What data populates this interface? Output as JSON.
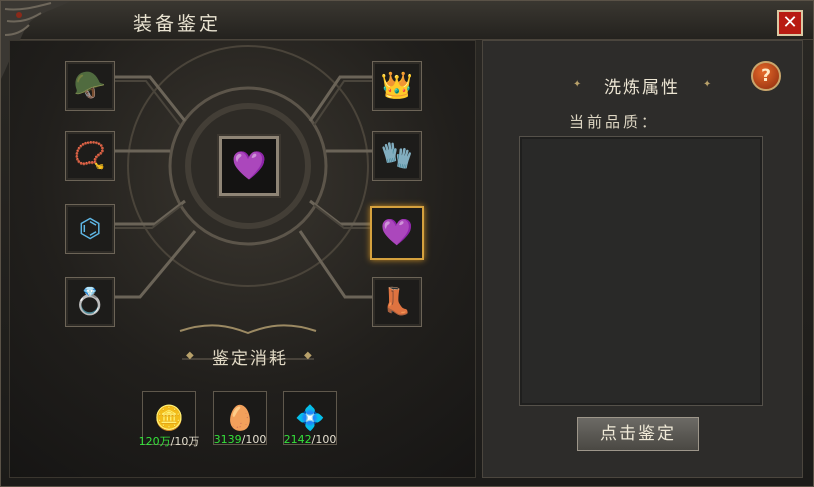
{
  "window": {
    "title": "装备鉴定",
    "close_icon": "close-icon"
  },
  "left_slots": [
    {
      "icon": "helmet-icon",
      "glyph": "🪖",
      "selected": false
    },
    {
      "icon": "necklace-icon",
      "glyph": "📿",
      "selected": false
    },
    {
      "icon": "bracelet-icon",
      "glyph": "⌬",
      "selected": false
    },
    {
      "icon": "ring-icon",
      "glyph": "💍",
      "selected": false
    }
  ],
  "right_slots": [
    {
      "icon": "crown-icon",
      "glyph": "👑",
      "selected": false
    },
    {
      "icon": "glove-icon",
      "glyph": "🧤",
      "selected": false
    },
    {
      "icon": "ring-icon",
      "glyph": "💜",
      "selected": true
    },
    {
      "icon": "boot-icon",
      "glyph": "👢",
      "selected": false
    }
  ],
  "center_item": {
    "icon": "ring-icon",
    "glyph": "💜"
  },
  "cost": {
    "title": "鉴定消耗",
    "items": [
      {
        "icon": "gold-ingot-icon",
        "glyph": "🪙",
        "have": "120万",
        "need": "/10万"
      },
      {
        "icon": "golden-egg-icon",
        "glyph": "🥚",
        "have": "3139",
        "need": "/100"
      },
      {
        "icon": "crystal-icon",
        "glyph": "💠",
        "have": "2142",
        "need": "/100"
      }
    ]
  },
  "panel": {
    "title": "洗炼属性",
    "help": "?",
    "quality_label": "当前品质：",
    "button_label": "点击鉴定"
  }
}
